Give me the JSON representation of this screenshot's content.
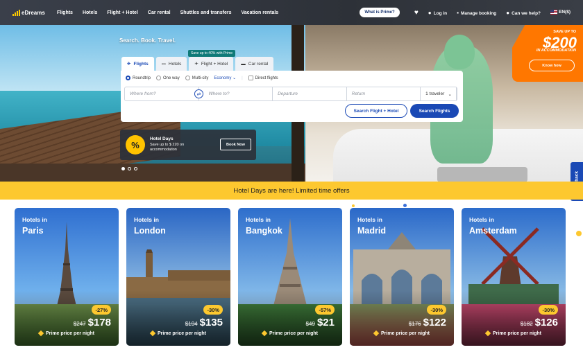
{
  "nav": {
    "logo": "eDreams",
    "items": [
      "Flights",
      "Hotels",
      "Flight + Hotel",
      "Car rental",
      "Shuttles and transfers",
      "Vacation rentals"
    ],
    "prime": "What is Prime?",
    "login": "Log in",
    "manage": "Manage booking",
    "help": "Can we help?",
    "lang": "EN($)"
  },
  "hero": {
    "tagline": "Search. Book. Travel.",
    "promo": {
      "small": "SAVE UP TO",
      "big": "$200",
      "sub": "IN ACCOMMODATION",
      "button": "Know how"
    }
  },
  "search": {
    "tabs": [
      {
        "label": "Flights",
        "icon": "plane-icon"
      },
      {
        "label": "Hotels",
        "icon": "bed-icon"
      },
      {
        "label": "Flight + Hotel",
        "icon": "flight-hotel-icon"
      },
      {
        "label": "Car rental",
        "icon": "car-icon"
      }
    ],
    "tab_badge": "Save up to 40% with Prime",
    "trip_types": [
      "Roundtrip",
      "One way",
      "Multi-city"
    ],
    "cabin": "Economy",
    "direct": "Direct flights",
    "from_placeholder": "Where from?",
    "to_placeholder": "Where to?",
    "departure_placeholder": "Departure",
    "return_placeholder": "Return",
    "travelers": "1 traveler",
    "btn_hotel": "Search Flight + Hotel",
    "btn_flights": "Search Flights"
  },
  "hotel_days": {
    "icon": "%",
    "title": "Hotel Days",
    "text": "Save up to $ 220 on accommodation",
    "button": "Book Now"
  },
  "feedback": "Feedback",
  "banner": "Hotel Days are here! Limited time offers",
  "cards": [
    {
      "small": "Hotels in",
      "city": "Paris",
      "discount": "-27%",
      "old": "$247",
      "new": "$178",
      "prime": "Prime price per night"
    },
    {
      "small": "Hotels in",
      "city": "London",
      "discount": "-30%",
      "old": "$194",
      "new": "$135",
      "prime": "Prime price per night"
    },
    {
      "small": "Hotels in",
      "city": "Bangkok",
      "discount": "-57%",
      "old": "$49",
      "new": "$21",
      "prime": "Prime price per night"
    },
    {
      "small": "Hotels in",
      "city": "Madrid",
      "discount": "-30%",
      "old": "$176",
      "new": "$122",
      "prime": "Prime price per night"
    },
    {
      "small": "Hotels in",
      "city": "Amsterdam",
      "discount": "-30%",
      "old": "$182",
      "new": "$126",
      "prime": "Prime price per night"
    }
  ],
  "colors": {
    "brand_blue": "#1a49b5",
    "accent_yellow": "#fdc82f",
    "promo_orange": "#ff7700"
  }
}
